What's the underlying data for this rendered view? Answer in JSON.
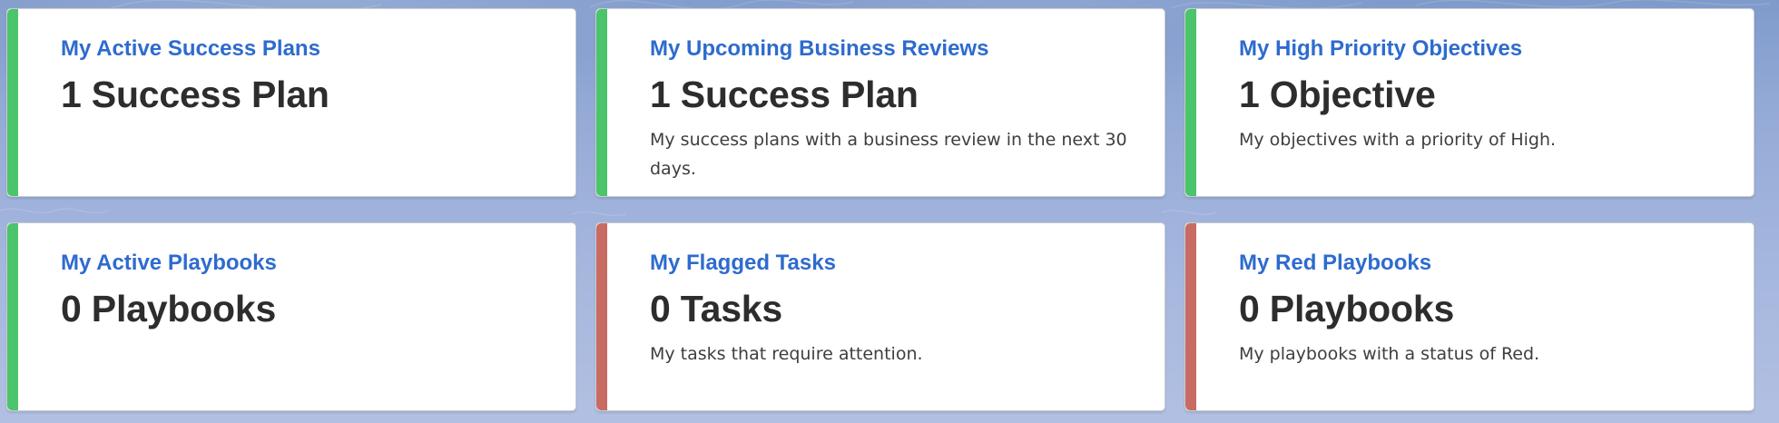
{
  "colors": {
    "green_status": "#4bc46b",
    "red_status": "#c86b63",
    "link_blue": "#2e6bce",
    "metric_text": "#2d2d2d",
    "desc_text": "#3e3e3c"
  },
  "cards": [
    {
      "title": "My Active Success Plans",
      "metric": "1 Success Plan",
      "description": "",
      "status": "green"
    },
    {
      "title": "My Upcoming Business Reviews",
      "metric": "1 Success Plan",
      "description": "My success plans with a business review in the next 30 days.",
      "status": "green"
    },
    {
      "title": "My High Priority Objectives",
      "metric": "1 Objective",
      "description": "My objectives with a priority of High.",
      "status": "green"
    },
    {
      "title": "My Active Playbooks",
      "metric": "0 Playbooks",
      "description": "",
      "status": "green"
    },
    {
      "title": "My Flagged Tasks",
      "metric": "0 Tasks",
      "description": "My tasks that require attention.",
      "status": "red"
    },
    {
      "title": "My Red Playbooks",
      "metric": "0 Playbooks",
      "description": "My playbooks with a status of Red.",
      "status": "red"
    }
  ]
}
